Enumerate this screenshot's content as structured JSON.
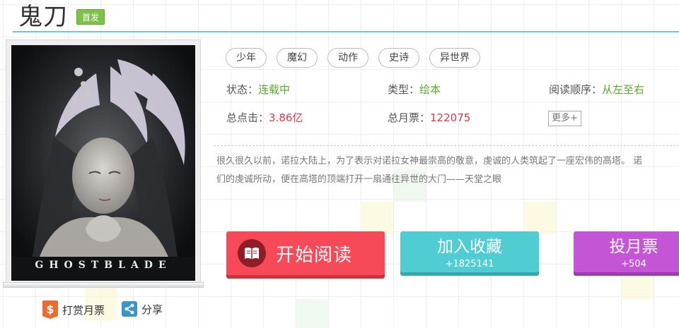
{
  "title": "鬼刀",
  "badge": "首发",
  "cover": {
    "text": "GHOSTBLADE"
  },
  "tags": [
    "少年",
    "魔幻",
    "动作",
    "史诗",
    "异世界"
  ],
  "info": {
    "status_label": "状态：",
    "status_value": "连载中",
    "type_label": "类型：",
    "type_value": "绘本",
    "order_label": "阅读顺序：",
    "order_value": "从左至右",
    "clicks_label": "总点击：",
    "clicks_value": "3.86亿",
    "monthly_label": "总月票：",
    "monthly_value": "122075",
    "more": "更多+"
  },
  "description": {
    "line1": "很久很久以前，诺拉大陆上，为了表示对诺拉女神最崇高的敬意，虔诚的人类筑起了一座宏伟的高塔。  诺",
    "line2": "们的虔诚所动，便在高塔的顶端打开一扇通往异世的大门——天堂之眼"
  },
  "actions": {
    "read": "开始阅读",
    "collect": "加入收藏",
    "collect_count": "+1825141",
    "vote": "投月票",
    "vote_count": "+504"
  },
  "bottom": {
    "tip": "打赏月票",
    "share": "分享"
  },
  "colors": {
    "accent_blue": "#6cc6dd",
    "read_red": "#f74957",
    "collect_teal": "#4fcdd3",
    "vote_purple": "#c455d6",
    "green": "#58a82a",
    "red": "#d6394a"
  }
}
